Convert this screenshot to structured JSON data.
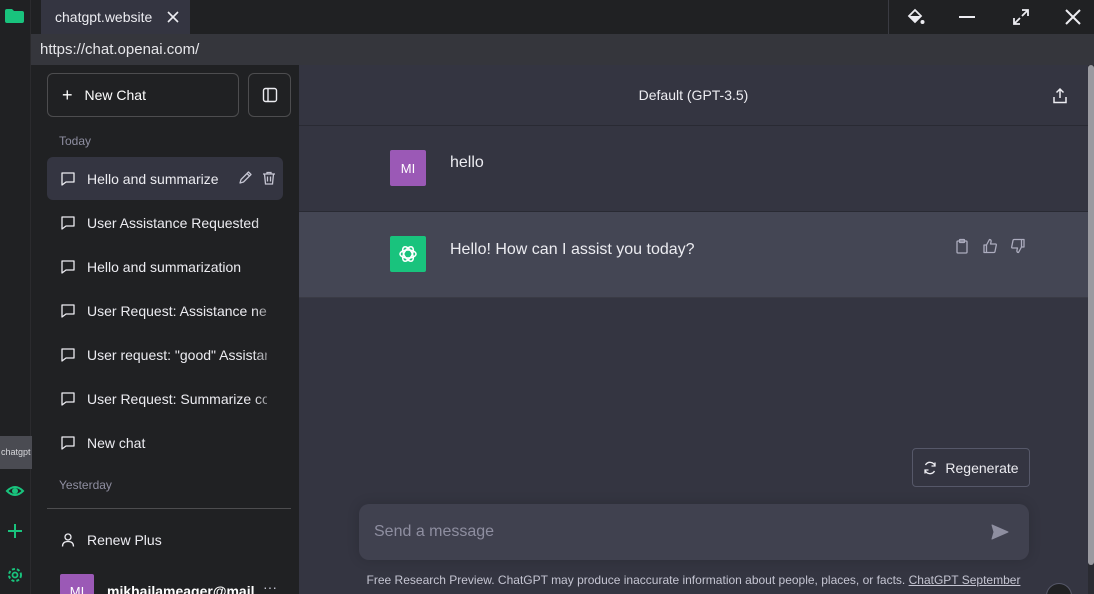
{
  "rail": {
    "tab_label": "chatgpt"
  },
  "browser": {
    "tab_title": "chatgpt.website",
    "url": "https://chat.openai.com/"
  },
  "sidebar": {
    "new_chat_label": "New Chat",
    "today_label": "Today",
    "yesterday_label": "Yesterday",
    "chats": [
      {
        "label": "Hello and summarize"
      },
      {
        "label": "User Assistance Requested"
      },
      {
        "label": "Hello and summarization"
      },
      {
        "label": "User Request: Assistance needed"
      },
      {
        "label": "User request: \"good\" Assistance"
      },
      {
        "label": "User Request: Summarize content"
      },
      {
        "label": "New chat"
      }
    ],
    "renew_label": "Renew Plus",
    "user_initials": "MI",
    "user_email": "mikhailameager@mail"
  },
  "main": {
    "model_title": "Default (GPT-3.5)",
    "messages": [
      {
        "role": "user",
        "avatar": "MI",
        "text": "hello"
      },
      {
        "role": "assistant",
        "text": "Hello! How can I assist you today?"
      }
    ],
    "regenerate_label": "Regenerate",
    "input_placeholder": "Send a message",
    "footer_text": "Free Research Preview. ChatGPT may produce inaccurate information about people, places, or facts.",
    "footer_link": "ChatGPT September"
  },
  "colors": {
    "sidebar_bg": "#202123",
    "main_bg": "#343541",
    "assistant_bg": "#444654",
    "accent_green": "#19c37d",
    "user_avatar": "#9b59b6"
  }
}
